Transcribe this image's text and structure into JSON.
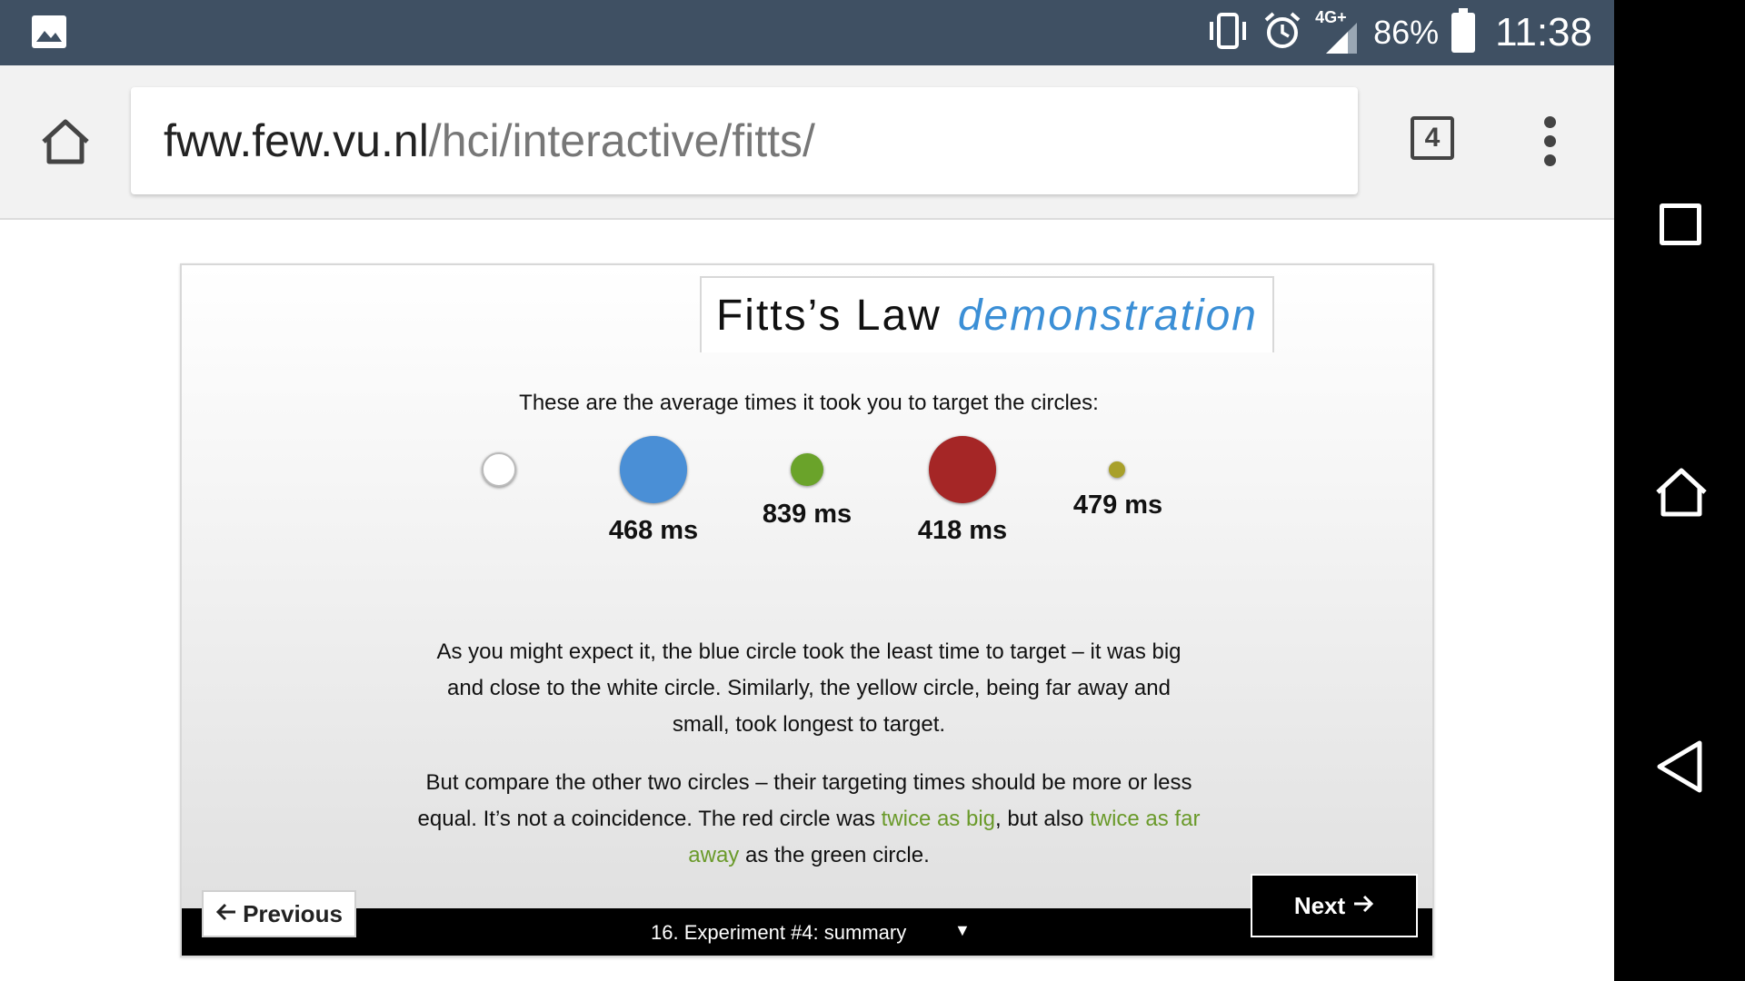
{
  "status_bar": {
    "network": "4G+",
    "battery": "86%",
    "time": "11:38",
    "icons": [
      "image-notification-icon",
      "vibrate-icon",
      "alarm-icon",
      "signal-icon",
      "battery-icon"
    ]
  },
  "browser": {
    "url_host": "fww.few.vu.nl",
    "url_path": "/hci/interactive/fitts/",
    "tab_count": "4"
  },
  "page": {
    "title_main": "Fitts’s Law",
    "title_accent": "demonstration",
    "intro": "These are the average times it took you to target the circles:",
    "circles": [
      {
        "color": "white",
        "hex": "#ffffff",
        "time": ""
      },
      {
        "color": "blue",
        "hex": "#4a8fd6",
        "time": "468 ms"
      },
      {
        "color": "green",
        "hex": "#6aa32a",
        "time": "839 ms"
      },
      {
        "color": "red",
        "hex": "#a52626",
        "time": "418 ms"
      },
      {
        "color": "yellow",
        "hex": "#a8a02a",
        "time": "479 ms"
      }
    ],
    "paragraph1": "As you might expect it, the blue circle took the least time to target – it was big and close to the white circle. Similarly, the yellow circle, being far away and small, took longest to target.",
    "paragraph2_a": "But compare the other two circles – their targeting times should be more or less equal. It’s not a coincidence. The red circle was ",
    "paragraph2_hl1": "twice as big",
    "paragraph2_b": ", but also ",
    "paragraph2_hl2": "twice as far away",
    "paragraph2_c": " as the green circle.",
    "prev_label": "Previous",
    "next_label": "Next",
    "chapter": "16. Experiment #4: summary"
  },
  "colors": {
    "status_bar_bg": "#3f5063",
    "accent_blue": "#3b8fd6",
    "highlight_green": "#6a9a2a"
  }
}
